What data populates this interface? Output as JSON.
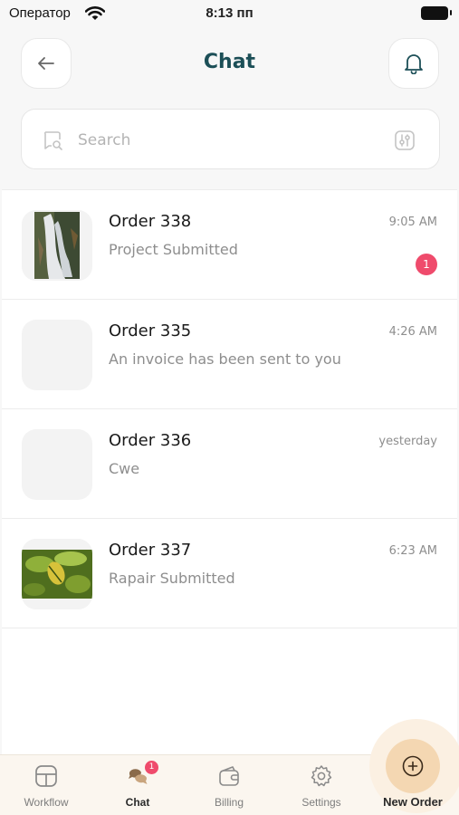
{
  "status_bar": {
    "carrier": "Оператор",
    "time": "8:13 пп"
  },
  "header": {
    "title": "Chat",
    "back_icon": "arrow-left-icon",
    "bell_icon": "bell-icon"
  },
  "search": {
    "placeholder": "Search",
    "search_icon": "chat-search-icon",
    "filter_icon": "filter-icon"
  },
  "chats": [
    {
      "title": "Order 338",
      "subtitle": "Project Submitted",
      "time": "9:05 AM",
      "unread": "1",
      "thumbnail": "waterfall-photo"
    },
    {
      "title": "Order 335",
      "subtitle": "An invoice has been sent to you",
      "time": "4:26 AM",
      "thumbnail": "empty"
    },
    {
      "title": "Order 336",
      "subtitle": "Cwe",
      "time": "yesterday",
      "thumbnail": "empty"
    },
    {
      "title": "Order 337",
      "subtitle": "Rapair Submitted",
      "time": "6:23 AM",
      "thumbnail": "leaf-photo"
    }
  ],
  "tabbar": {
    "workflow": {
      "label": "Workflow",
      "icon": "workflow-icon"
    },
    "chat": {
      "label": "Chat",
      "icon": "chat-bubbles-icon",
      "badge": "1"
    },
    "billing": {
      "label": "Billing",
      "icon": "wallet-icon"
    },
    "settings": {
      "label": "Settings",
      "icon": "gear-icon"
    },
    "new_order": {
      "label": "New Order",
      "icon": "plus-circle-icon"
    }
  },
  "colors": {
    "accent": "#1c4f57",
    "badge": "#ef4b6c",
    "fab": "#f4d7b2",
    "tabbar_bg": "#fbf6ef"
  }
}
